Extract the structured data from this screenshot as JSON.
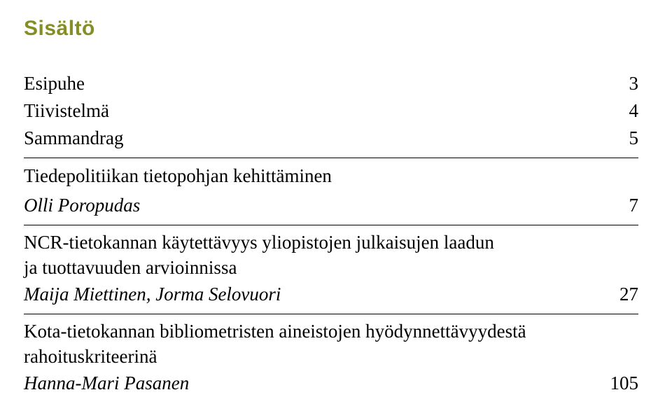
{
  "heading": "Sisältö",
  "entries": {
    "e1": {
      "title": "Esipuhe",
      "page": "3"
    },
    "e2": {
      "title": "Tiivistelmä",
      "page": "4"
    },
    "e3": {
      "title": "Sammandrag",
      "page": "5"
    },
    "e4": {
      "title": "Tiedepolitiikan tietopohjan kehittäminen",
      "author": "Olli Poropudas",
      "page": "7"
    },
    "e5": {
      "title_l1": "NCR-tietokannan käytettävyys yliopistojen julkaisujen laadun",
      "title_l2": "ja tuottavuuden arvioinnissa",
      "author": "Maija Miettinen, Jorma Selovuori",
      "page": "27"
    },
    "e6": {
      "title_l1": "Kota-tietokannan bibliometristen aineistojen hyödynnettävyydestä",
      "title_l2": "rahoituskriteerinä",
      "author": "Hanna-Mari Pasanen",
      "page": "105"
    }
  }
}
